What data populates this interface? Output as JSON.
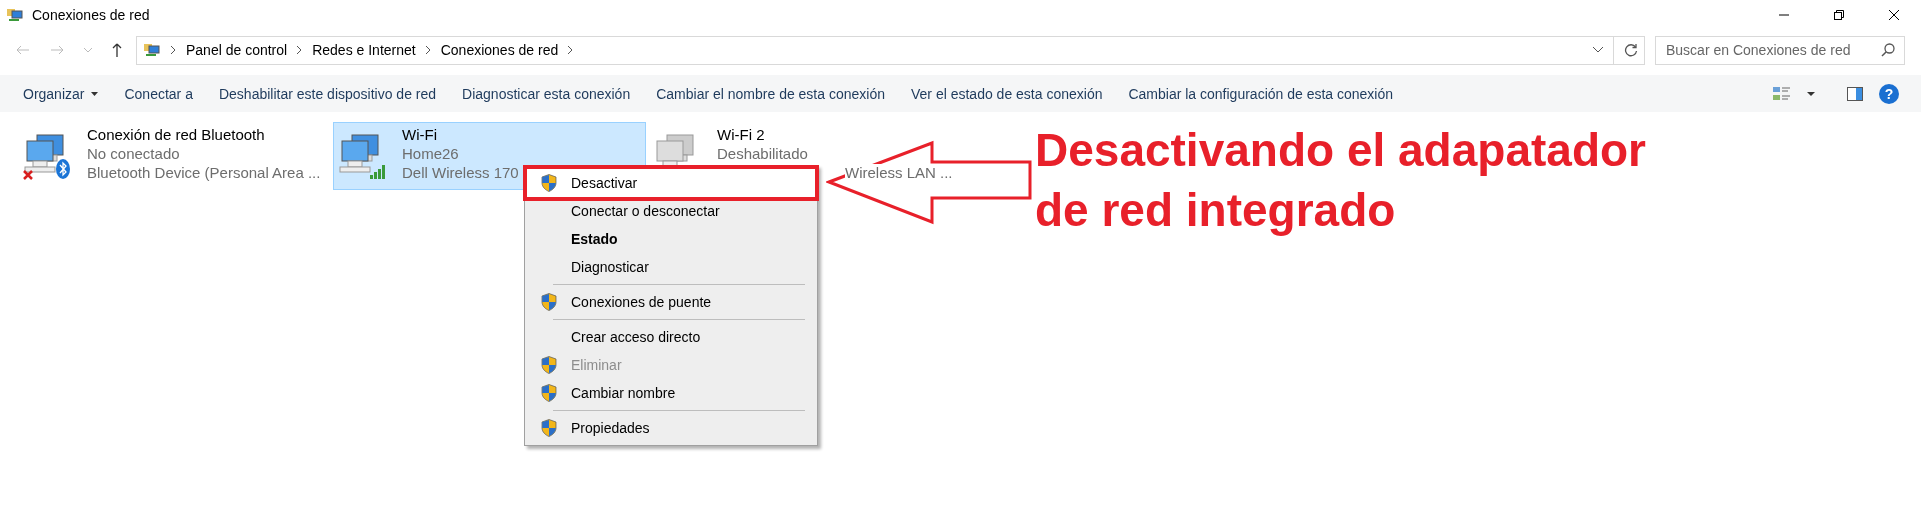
{
  "window": {
    "title": "Conexiones de red"
  },
  "address_bar": {
    "breadcrumb": [
      "Panel de control",
      "Redes e Internet",
      "Conexiones de red"
    ]
  },
  "search": {
    "placeholder": "Buscar en Conexiones de red"
  },
  "toolbar": [
    {
      "label": "Organizar",
      "kind": "dropdown"
    },
    {
      "label": "Conectar a",
      "kind": "command"
    },
    {
      "label": "Deshabilitar este dispositivo de red",
      "kind": "command"
    },
    {
      "label": "Diagnosticar esta conexión",
      "kind": "command"
    },
    {
      "label": "Cambiar el nombre de esta conexión",
      "kind": "command"
    },
    {
      "label": "Ver el estado de esta conexión",
      "kind": "command"
    },
    {
      "label": "Cambiar la configuración de esta conexión",
      "kind": "command"
    }
  ],
  "connections": [
    {
      "name": "Conexión de red Bluetooth",
      "status": "No conectado",
      "device": "Bluetooth Device (Personal Area ...",
      "kind": "bluetooth",
      "enabled": true,
      "connected": false,
      "selected": false
    },
    {
      "name": "Wi-Fi",
      "status": "Home26",
      "device": "Dell Wireless 170",
      "kind": "wifi",
      "enabled": true,
      "connected": true,
      "selected": true
    },
    {
      "name": "Wi-Fi 2",
      "status": "Deshabilitado",
      "device": "Wireless LAN ...",
      "kind": "wifi",
      "enabled": false,
      "selected": false
    }
  ],
  "context_menu": [
    {
      "kind": "item",
      "label": "Desactivar",
      "shield": true,
      "bold": false,
      "disabled": false,
      "selected": true
    },
    {
      "kind": "item",
      "label": "Conectar o desconectar",
      "shield": false,
      "bold": false,
      "disabled": false,
      "selected": false
    },
    {
      "kind": "item",
      "label": "Estado",
      "shield": false,
      "bold": true,
      "disabled": false,
      "selected": false
    },
    {
      "kind": "item",
      "label": "Diagnosticar",
      "shield": false,
      "bold": false,
      "disabled": false,
      "selected": false
    },
    {
      "kind": "separator"
    },
    {
      "kind": "item",
      "label": "Conexiones de puente",
      "shield": true,
      "bold": false,
      "disabled": false,
      "selected": false
    },
    {
      "kind": "separator"
    },
    {
      "kind": "item",
      "label": "Crear acceso directo",
      "shield": false,
      "bold": false,
      "disabled": false,
      "selected": false
    },
    {
      "kind": "item",
      "label": "Eliminar",
      "shield": true,
      "bold": false,
      "disabled": true,
      "selected": false
    },
    {
      "kind": "item",
      "label": "Cambiar nombre",
      "shield": true,
      "bold": false,
      "disabled": false,
      "selected": false
    },
    {
      "kind": "separator"
    },
    {
      "kind": "item",
      "label": "Propiedades",
      "shield": true,
      "bold": false,
      "disabled": false,
      "selected": false
    }
  ],
  "help": {
    "label": "?"
  },
  "annotation": {
    "text": "Desactivando el adapatador de red integrado"
  }
}
